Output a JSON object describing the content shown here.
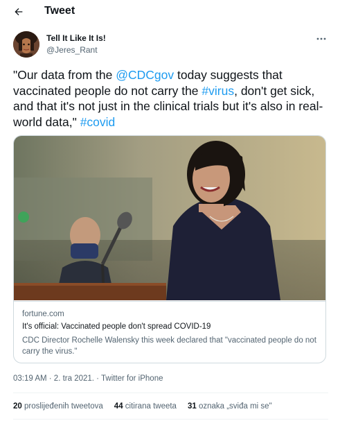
{
  "header": {
    "title": "Tweet",
    "back_icon": "arrow-left-icon"
  },
  "author": {
    "name": "Tell It Like It Is!",
    "handle": "@Jeres_Rant",
    "more_icon": "more-horizontal-icon"
  },
  "tweet": {
    "parts": [
      {
        "text": "\"Our data from the ",
        "type": "text"
      },
      {
        "text": "@CDCgov",
        "type": "link"
      },
      {
        "text": " today suggests that vaccinated people do not carry the ",
        "type": "text"
      },
      {
        "text": "#virus",
        "type": "link"
      },
      {
        "text": ", don't get sick, and that it's not just in the clinical trials but it's also in real-world data,\"  ",
        "type": "text"
      },
      {
        "text": "#covid",
        "type": "link"
      }
    ]
  },
  "card": {
    "domain": "fortune.com",
    "title": "It's official: Vaccinated people don't spread COVID-19",
    "description": "CDC Director Rochelle Walensky this week declared that \"vaccinated people do not carry the virus.\""
  },
  "meta": {
    "timestamp": "03:19 AM · 2. tra 2021. · Twitter for iPhone"
  },
  "stats": [
    {
      "count": "20",
      "label": "proslijeđenih tweetova"
    },
    {
      "count": "44",
      "label": "citirana tweeta"
    },
    {
      "count": "31",
      "label": "oznaka „sviđa mi se\""
    }
  ],
  "colors": {
    "link": "#1d9bf0",
    "secondary_text": "#536471",
    "border": "#cfd9de"
  }
}
